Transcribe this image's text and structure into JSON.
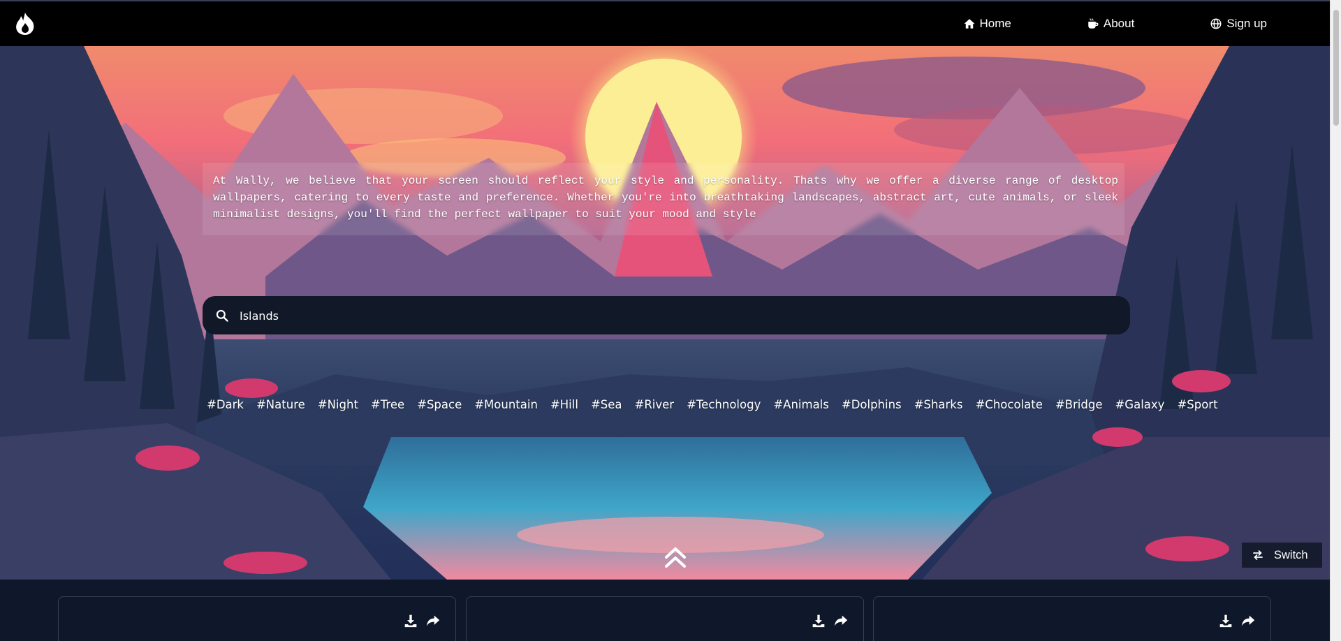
{
  "nav": {
    "logo_icon": "flame-icon",
    "items": [
      {
        "label": "Home",
        "icon": "home-icon"
      },
      {
        "label": "About",
        "icon": "coffee-mug-icon"
      },
      {
        "label": "Sign up",
        "icon": "globe-icon"
      }
    ]
  },
  "hero": {
    "intro": "At Wally, we believe that your screen should reflect your style and personality. Thats why we offer a diverse range of desktop wallpapers, catering to every taste and preference. Whether you're into breathtaking landscapes, abstract art, cute animals, or sleek minimalist designs, you'll find the perfect wallpaper to suit your mood and style",
    "search": {
      "value": "Islands",
      "icon": "search-icon"
    },
    "tags": [
      "#Dark",
      "#Nature",
      "#Night",
      "#Tree",
      "#Space",
      "#Mountain",
      "#Hill",
      "#Sea",
      "#River",
      "#Technology",
      "#Animals",
      "#Dolphins",
      "#Sharks",
      "#Chocolate",
      "#Bridge",
      "#Galaxy",
      "#Sport"
    ],
    "scroll_up_icon": "double-chevron-up-icon",
    "switch": {
      "label": "Switch",
      "icon": "swap-arrows-icon"
    }
  },
  "gallery": {
    "cards": [
      {
        "download_icon": "download-icon",
        "share_icon": "share-icon"
      },
      {
        "download_icon": "download-icon",
        "share_icon": "share-icon"
      },
      {
        "download_icon": "download-icon",
        "share_icon": "share-icon"
      }
    ]
  },
  "colors": {
    "navbar": "#000000",
    "search_bg": "#111827",
    "gallery_bg": "#0f172a",
    "card_border": "#374151"
  }
}
